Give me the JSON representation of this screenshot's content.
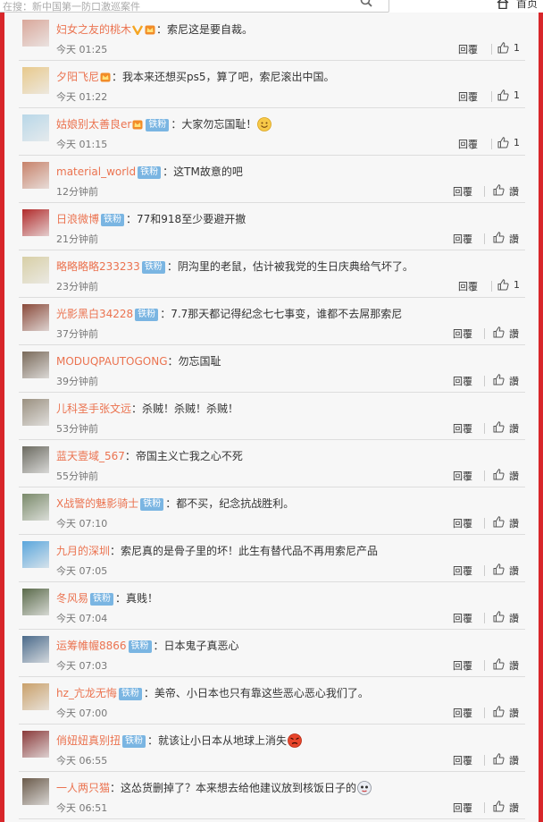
{
  "header": {
    "search_placeholder": "在搜：新中国第一防口激巡案件",
    "home_label": "首页"
  },
  "actions": {
    "reply_label": "回覆",
    "zan_label": "讚"
  },
  "badges": {
    "fan": "铁粉"
  },
  "colors": {
    "accent_red": "#d8262a",
    "username": "#eb7350",
    "badge": "#7ab5e2"
  },
  "comments": [
    {
      "user": "妇女之友的桃木",
      "vip": true,
      "crown": true,
      "badge": false,
      "text": "：索尼这是要自裁。",
      "emoji": "",
      "time": "今天 01:25",
      "like": "1",
      "avatar_color": "#d9a79a"
    },
    {
      "user": "夕阳飞尼",
      "vip": false,
      "crown": true,
      "badge": false,
      "text": "：我本来还想买ps5，算了吧，索尼滚出中国。",
      "emoji": "",
      "time": "今天 01:22",
      "like": "1",
      "avatar_color": "#e8c98c"
    },
    {
      "user": "姑娘别太善良er",
      "vip": false,
      "crown": true,
      "badge": true,
      "badge_text": "铁粉",
      "text": "：大家勿忘国耻！",
      "emoji": "smile",
      "time": "今天 01:15",
      "like": "1",
      "avatar_color": "#b8d7e8"
    },
    {
      "user": "material_world",
      "vip": false,
      "crown": false,
      "badge": true,
      "badge_text": "铁粉",
      "text": "：这TM故意的吧",
      "emoji": "",
      "time": "12分钟前",
      "like": "",
      "avatar_color": "#c7826a"
    },
    {
      "user": "日浪微博",
      "vip": false,
      "crown": false,
      "badge": true,
      "badge_text": "铁粉",
      "text": "：77和918至少要避开撤",
      "emoji": "",
      "time": "21分钟前",
      "like": "",
      "avatar_color": "#b12a2a"
    },
    {
      "user": "略略略略233233",
      "vip": false,
      "crown": false,
      "badge": true,
      "badge_text": "铁粉",
      "text": "：阴沟里的老鼠，估计被我党的生日庆典给气坏了。",
      "emoji": "",
      "time": "23分钟前",
      "like": "1",
      "avatar_color": "#d8cfa6"
    },
    {
      "user": "光影黑白34228",
      "vip": false,
      "crown": false,
      "badge": true,
      "badge_text": "铁粉",
      "text": "：7.7那天都记得纪念七七事变，谁都不去屌那索尼",
      "emoji": "",
      "time": "37分钟前",
      "like": "",
      "avatar_color": "#8a4a3a"
    },
    {
      "user": "MODUQPAUTOGONG",
      "vip": false,
      "crown": false,
      "badge": false,
      "text": "：勿忘国耻",
      "emoji": "",
      "time": "39分钟前",
      "like": "",
      "avatar_color": "#7a6a5a"
    },
    {
      "user": "儿科圣手张文远",
      "vip": false,
      "crown": false,
      "badge": false,
      "text": "：杀贼！杀贼！杀贼！",
      "emoji": "",
      "time": "53分钟前",
      "like": "",
      "avatar_color": "#9a9080"
    },
    {
      "user": "蓝天壹域_567",
      "vip": false,
      "crown": false,
      "badge": false,
      "text": "：帝国主义亡我之心不死",
      "emoji": "",
      "time": "55分钟前",
      "like": "",
      "avatar_color": "#6b6a60"
    },
    {
      "user": "X战警的魅影骑士",
      "vip": false,
      "crown": false,
      "badge": true,
      "badge_text": "铁粉",
      "text": "：都不买，纪念抗战胜利。",
      "emoji": "",
      "time": "今天 07:10",
      "like": "",
      "avatar_color": "#7a8a6a"
    },
    {
      "user": "九月的深圳",
      "vip": false,
      "crown": false,
      "badge": false,
      "text": "：索尼真的是骨子里的坏！此生有替代品不再用索尼产品",
      "emoji": "",
      "time": "今天 07:05",
      "like": "",
      "avatar_color": "#5aa6dc"
    },
    {
      "user": "冬风易",
      "vip": false,
      "crown": false,
      "badge": true,
      "badge_text": "铁粉",
      "text": "：真贱！",
      "emoji": "",
      "time": "今天 07:04",
      "like": "",
      "avatar_color": "#5a6a4a"
    },
    {
      "user": "运筹帷幄8866",
      "vip": false,
      "crown": false,
      "badge": true,
      "badge_text": "铁粉",
      "text": "：日本鬼子真恶心",
      "emoji": "",
      "time": "今天 07:03",
      "like": "",
      "avatar_color": "#4a6a8a"
    },
    {
      "user": "hz_亢龙无悔",
      "vip": false,
      "crown": false,
      "badge": true,
      "badge_text": "铁粉",
      "text": "：美帝、小日本也只有靠这些恶心恶心我们了。",
      "emoji": "",
      "time": "今天 07:00",
      "like": "",
      "avatar_color": "#c9a06a"
    },
    {
      "user": "俏妞妞真别扭",
      "vip": false,
      "crown": false,
      "badge": true,
      "badge_text": "铁粉",
      "text": "：就该让小日本从地球上消失",
      "emoji": "angry",
      "time": "今天 06:55",
      "like": "",
      "avatar_color": "#8a3a3a"
    },
    {
      "user": "一人两只猫",
      "vip": false,
      "crown": false,
      "badge": false,
      "text": "：这怂货删掉了？本来想去给他建议放到核饭日子的",
      "emoji": "doge",
      "time": "今天 06:51",
      "like": "",
      "avatar_color": "#6a5a4a"
    }
  ]
}
